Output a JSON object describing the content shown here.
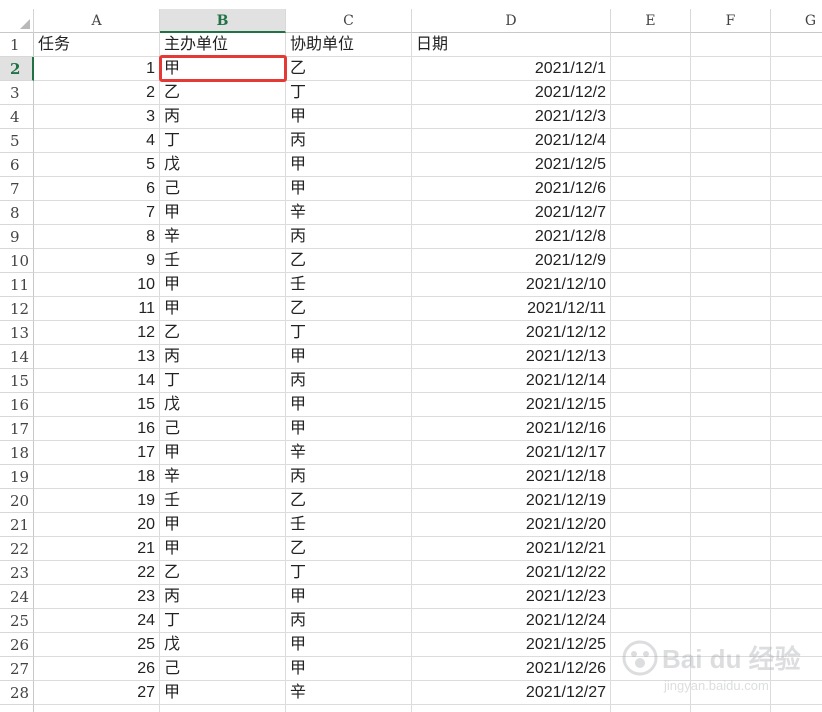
{
  "columns": [
    "A",
    "B",
    "C",
    "D",
    "E",
    "F",
    "G"
  ],
  "active_column": "B",
  "active_row": 2,
  "header_row": {
    "row_label": "1",
    "A": "任务",
    "B": "主办单位",
    "C": "协助单位",
    "D": "日期"
  },
  "rows": [
    {
      "n": "2",
      "a": "1",
      "b": "甲",
      "c": "乙",
      "d": "2021/12/1"
    },
    {
      "n": "3",
      "a": "2",
      "b": "乙",
      "c": "丁",
      "d": "2021/12/2"
    },
    {
      "n": "4",
      "a": "3",
      "b": "丙",
      "c": "甲",
      "d": "2021/12/3"
    },
    {
      "n": "5",
      "a": "4",
      "b": "丁",
      "c": "丙",
      "d": "2021/12/4"
    },
    {
      "n": "6",
      "a": "5",
      "b": "戊",
      "c": "甲",
      "d": "2021/12/5"
    },
    {
      "n": "7",
      "a": "6",
      "b": "己",
      "c": "甲",
      "d": "2021/12/6"
    },
    {
      "n": "8",
      "a": "7",
      "b": "甲",
      "c": "辛",
      "d": "2021/12/7"
    },
    {
      "n": "9",
      "a": "8",
      "b": "辛",
      "c": "丙",
      "d": "2021/12/8"
    },
    {
      "n": "10",
      "a": "9",
      "b": "壬",
      "c": "乙",
      "d": "2021/12/9"
    },
    {
      "n": "11",
      "a": "10",
      "b": "甲",
      "c": "壬",
      "d": "2021/12/10"
    },
    {
      "n": "12",
      "a": "11",
      "b": "甲",
      "c": "乙",
      "d": "2021/12/11"
    },
    {
      "n": "13",
      "a": "12",
      "b": "乙",
      "c": "丁",
      "d": "2021/12/12"
    },
    {
      "n": "14",
      "a": "13",
      "b": "丙",
      "c": "甲",
      "d": "2021/12/13"
    },
    {
      "n": "15",
      "a": "14",
      "b": "丁",
      "c": "丙",
      "d": "2021/12/14"
    },
    {
      "n": "16",
      "a": "15",
      "b": "戊",
      "c": "甲",
      "d": "2021/12/15"
    },
    {
      "n": "17",
      "a": "16",
      "b": "己",
      "c": "甲",
      "d": "2021/12/16"
    },
    {
      "n": "18",
      "a": "17",
      "b": "甲",
      "c": "辛",
      "d": "2021/12/17"
    },
    {
      "n": "19",
      "a": "18",
      "b": "辛",
      "c": "丙",
      "d": "2021/12/18"
    },
    {
      "n": "20",
      "a": "19",
      "b": "壬",
      "c": "乙",
      "d": "2021/12/19"
    },
    {
      "n": "21",
      "a": "20",
      "b": "甲",
      "c": "壬",
      "d": "2021/12/20"
    },
    {
      "n": "22",
      "a": "21",
      "b": "甲",
      "c": "乙",
      "d": "2021/12/21"
    },
    {
      "n": "23",
      "a": "22",
      "b": "乙",
      "c": "丁",
      "d": "2021/12/22"
    },
    {
      "n": "24",
      "a": "23",
      "b": "丙",
      "c": "甲",
      "d": "2021/12/23"
    },
    {
      "n": "25",
      "a": "24",
      "b": "丁",
      "c": "丙",
      "d": "2021/12/24"
    },
    {
      "n": "26",
      "a": "25",
      "b": "戊",
      "c": "甲",
      "d": "2021/12/25"
    },
    {
      "n": "27",
      "a": "26",
      "b": "己",
      "c": "甲",
      "d": "2021/12/26"
    },
    {
      "n": "28",
      "a": "27",
      "b": "甲",
      "c": "辛",
      "d": "2021/12/27"
    }
  ],
  "colors": {
    "selection_border": "#e53935",
    "active_header": "#217346",
    "gridline": "#dcdcdc"
  },
  "watermark": {
    "brand": "Bai du 经验",
    "url": "jingyan.baidu.com"
  }
}
